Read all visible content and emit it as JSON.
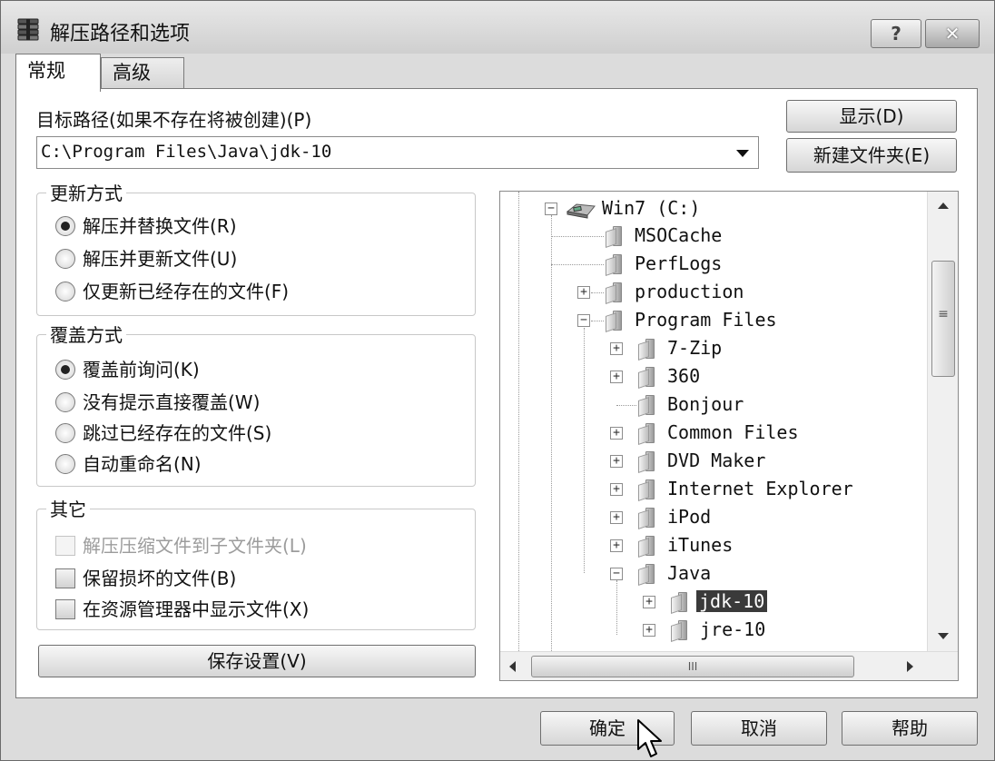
{
  "window": {
    "title": "解压路径和选项",
    "help_label": "?",
    "close_label": "✕",
    "icon": "archive-stack-icon"
  },
  "tabs": [
    {
      "label": "常规",
      "active": true
    },
    {
      "label": "高级",
      "active": false
    }
  ],
  "destination": {
    "label": "目标路径(如果不存在将被创建)(P)",
    "value": "C:\\Program Files\\Java\\jdk-10",
    "show_button": "显示(D)",
    "new_folder_button": "新建文件夹(E)"
  },
  "update_mode": {
    "title": "更新方式",
    "options": [
      {
        "label": "解压并替换文件(R)",
        "checked": true
      },
      {
        "label": "解压并更新文件(U)",
        "checked": false
      },
      {
        "label": "仅更新已经存在的文件(F)",
        "checked": false
      }
    ]
  },
  "overwrite_mode": {
    "title": "覆盖方式",
    "options": [
      {
        "label": "覆盖前询问(K)",
        "checked": true
      },
      {
        "label": "没有提示直接覆盖(W)",
        "checked": false
      },
      {
        "label": "跳过已经存在的文件(S)",
        "checked": false
      },
      {
        "label": "自动重命名(N)",
        "checked": false
      }
    ]
  },
  "misc": {
    "title": "其它",
    "options": [
      {
        "label": "解压压缩文件到子文件夹(L)",
        "checked": false,
        "disabled": true
      },
      {
        "label": "保留损坏的文件(B)",
        "checked": false,
        "disabled": false
      },
      {
        "label": "在资源管理器中显示文件(X)",
        "checked": false,
        "disabled": false
      }
    ]
  },
  "save_settings_button": "保存设置(V)",
  "tree": {
    "items": [
      {
        "label": "Win7 (C:)",
        "type": "drive",
        "expanded": true
      },
      {
        "label": "MSOCache",
        "type": "folder"
      },
      {
        "label": "PerfLogs",
        "type": "folder"
      },
      {
        "label": "production",
        "type": "folder",
        "expander": "+"
      },
      {
        "label": "Program Files",
        "type": "folder",
        "expander": "-"
      },
      {
        "label": "7-Zip",
        "type": "folder",
        "expander": "+"
      },
      {
        "label": "360",
        "type": "folder",
        "expander": "+"
      },
      {
        "label": "Bonjour",
        "type": "folder"
      },
      {
        "label": "Common Files",
        "type": "folder",
        "expander": "+"
      },
      {
        "label": "DVD Maker",
        "type": "folder",
        "expander": "+"
      },
      {
        "label": "Internet Explorer",
        "type": "folder",
        "expander": "+"
      },
      {
        "label": "iPod",
        "type": "folder",
        "expander": "+"
      },
      {
        "label": "iTunes",
        "type": "folder",
        "expander": "+"
      },
      {
        "label": "Java",
        "type": "folder",
        "expander": "-"
      },
      {
        "label": "jdk-10",
        "type": "folder",
        "expander": "+",
        "selected": true
      },
      {
        "label": "jre-10",
        "type": "folder",
        "expander": "+"
      }
    ],
    "hscroll_grip": "III",
    "vscroll_grip": "≡"
  },
  "footer": {
    "ok": "确定",
    "cancel": "取消",
    "help": "帮助"
  }
}
